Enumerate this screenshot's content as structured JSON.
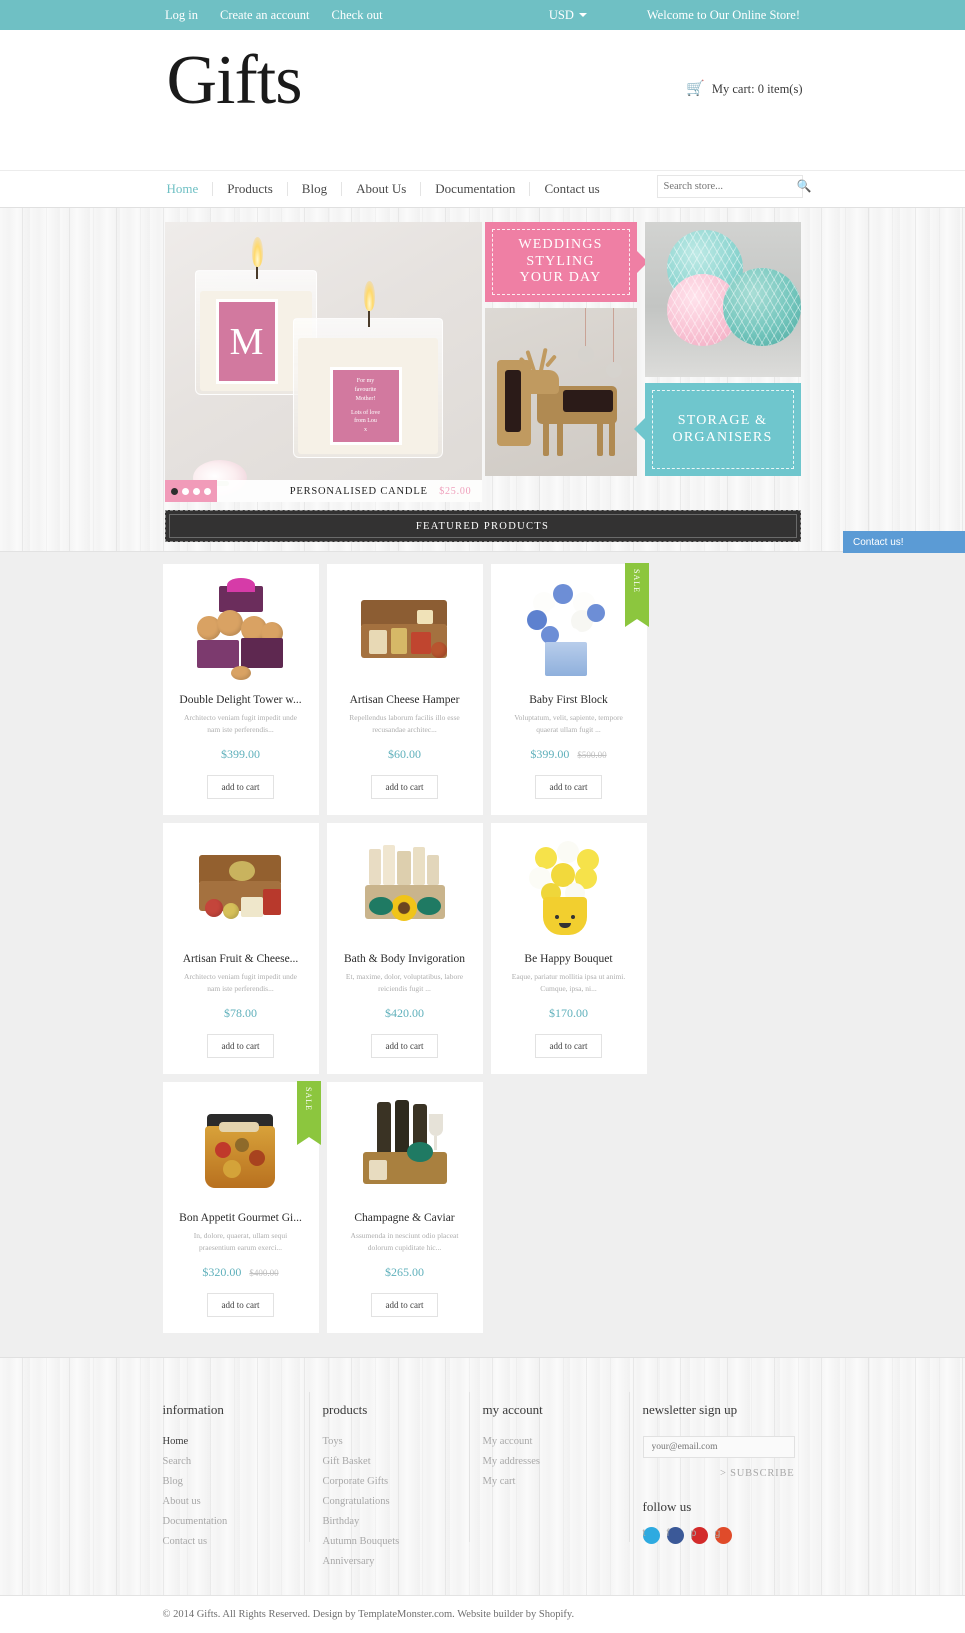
{
  "topbar": {
    "links": [
      "Log in",
      "Create an account",
      "Check out"
    ],
    "currency": "USD",
    "welcome": "Welcome to Our Online Store!",
    "bg_color": "#6fc0c4"
  },
  "header": {
    "logo": "Gifts",
    "cart_label": "My cart: 0 item(s)",
    "cart_icon": "cart-icon"
  },
  "nav": {
    "items": [
      {
        "label": "Home",
        "active": true
      },
      {
        "label": "Products",
        "active": false
      },
      {
        "label": "Blog",
        "active": false
      },
      {
        "label": "About Us",
        "active": false
      },
      {
        "label": "Documentation",
        "active": false
      },
      {
        "label": "Contact us",
        "active": false
      }
    ],
    "search_placeholder": "Search store...",
    "search_value": "",
    "search_icon": "search-icon"
  },
  "hero": {
    "slider": {
      "caption": "PERSONALISED CANDLE",
      "price": "$25.00",
      "dots": 4,
      "active_dot": 1,
      "candle_label_letter": "M",
      "candle_label_msg_1": "For my",
      "candle_label_msg_2": "favourite",
      "candle_label_msg_3": "Mother!",
      "candle_label_msg_4": "Lots of love",
      "candle_label_msg_5": "from Lou",
      "candle_label_msg_6": "x"
    },
    "tiles": [
      {
        "line1": "WEDDINGS",
        "line2": "STYLING",
        "line3": "YOUR DAY",
        "color": "#ef7fa4"
      },
      {
        "line1": "STORAGE &",
        "line2": "ORGANISERS",
        "color": "#6fc6cd"
      }
    ],
    "featured_title": "FEATURED PRODUCTS"
  },
  "products": [
    {
      "name": "Double Delight Tower w...",
      "desc": "Architecto veniam fugit impedit unde nam iste perferendis...",
      "price": "$399.00",
      "old_price": "",
      "sale": false,
      "button": "add to cart"
    },
    {
      "name": "Artisan Cheese Hamper",
      "desc": "Repellendus laborum facilis illo esse recusandae architec...",
      "price": "$60.00",
      "old_price": "",
      "sale": false,
      "button": "add to cart"
    },
    {
      "name": "Baby First Block",
      "desc": "Voluptatum, velit, sapiente, tempore quaerat ullam fugit ...",
      "price": "$399.00",
      "old_price": "$500.00",
      "sale": true,
      "sale_label": "SALE",
      "button": "add to cart"
    },
    {
      "name": "Artisan Fruit & Cheese...",
      "desc": "Architecto veniam fugit impedit unde nam iste perferendis...",
      "price": "$78.00",
      "old_price": "",
      "sale": false,
      "button": "add to cart"
    },
    {
      "name": "Bath & Body Invigoration",
      "desc": "Et, maxime, dolor, voluptatibus, labore reiciendis fugit ...",
      "price": "$420.00",
      "old_price": "",
      "sale": false,
      "button": "add to cart"
    },
    {
      "name": "Be Happy Bouquet",
      "desc": "Eaque, pariatur mollitia ipsa ut animi. Cumque, ipsa, ni...",
      "price": "$170.00",
      "old_price": "",
      "sale": false,
      "button": "add to cart"
    },
    {
      "name": "Bon Appetit Gourmet Gi...",
      "desc": "In, dolore, quaerat, ullam sequi praesentium earum exerci...",
      "price": "$320.00",
      "old_price": "$400.00",
      "sale": true,
      "sale_label": "SALE",
      "button": "add to cart"
    },
    {
      "name": "Champagne & Caviar",
      "desc": "Assumenda in nesciunt odio placeat dolorum cupiditate hic...",
      "price": "$265.00",
      "old_price": "",
      "sale": false,
      "button": "add to cart"
    }
  ],
  "contact_tab": {
    "label": "Contact us!",
    "color": "#5b9bd5"
  },
  "footer": {
    "columns": [
      {
        "title": "information",
        "links": [
          "Home",
          "Search",
          "Blog",
          "About us",
          "Documentation",
          "Contact us"
        ],
        "current": "Home"
      },
      {
        "title": "products",
        "links": [
          "Toys",
          "Gift Basket",
          "Corporate Gifts",
          "Congratulations",
          "Birthday",
          "Autumn Bouquets",
          "Anniversary"
        ],
        "current": ""
      },
      {
        "title": "my account",
        "links": [
          "My account",
          "My addresses",
          "My cart"
        ],
        "current": ""
      }
    ],
    "newsletter": {
      "title": "newsletter sign up",
      "placeholder": "your@email.com",
      "value": "",
      "subscribe": "> SUBSCRIBE"
    },
    "follow": {
      "title": "follow us",
      "socials": [
        {
          "name": "twitter",
          "glyph": "t",
          "color": "#2eaae0"
        },
        {
          "name": "facebook",
          "glyph": "f",
          "color": "#3b5998"
        },
        {
          "name": "pinterest",
          "glyph": "p",
          "color": "#d32b2b"
        },
        {
          "name": "google-plus",
          "glyph": "g",
          "color": "#e04b2a"
        }
      ]
    },
    "copyright": "© 2014 Gifts. All Rights Reserved. Design by TemplateMonster.com. Website builder by Shopify."
  }
}
